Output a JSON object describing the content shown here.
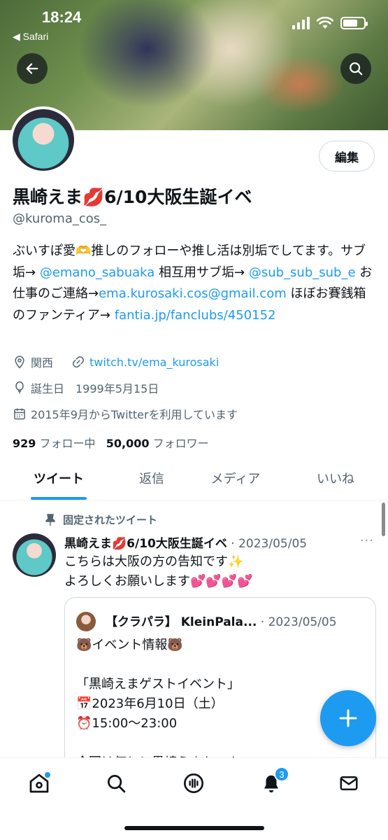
{
  "status_bar": {
    "time": "18:24",
    "back_app": "◀ Safari"
  },
  "profile": {
    "edit_label": "編集",
    "display_name": "黒崎えま💋6/10大阪生誕イベ",
    "handle": "@kuroma_cos_",
    "bio": {
      "p1": "ぶいすぽ愛🫶推しのフォローや推し活は別垢でしてます。サブ垢→ ",
      "link1": "@emano_sabuaka",
      "p2": " 相互用サブ垢→ ",
      "link2": "@sub_sub_sub_e",
      "p3": " お仕事のご連絡→",
      "link3": "ema.kurosaki.cos@gmail.com",
      "p4": " ほぼお賽銭箱のファンティア→ ",
      "link4": "fantia.jp/fanclubs/450152"
    },
    "location": "関西",
    "website": "twitch.tv/ema_kurosaki",
    "birthday": "誕生日　1999年5月15日",
    "joined": "2015年9月からTwitterを利用しています",
    "following_count": "929",
    "following_label": "フォロー中",
    "followers_count": "50,000",
    "followers_label": "フォロワー"
  },
  "tabs": [
    "ツイート",
    "返信",
    "メディア",
    "いいね"
  ],
  "tweet": {
    "pinned_label": "固定されたツイート",
    "author": "黒崎えま💋6/10大阪生誕イベ",
    "date": "· 2023/05/05",
    "more": "···",
    "line1": "こちらは大阪の方の告知です✨",
    "line2": "よろしくお願いします💕💕💕💕",
    "quote": {
      "author": "【クラパラ】 KleinPala...",
      "date": "· 2023/05/05",
      "text": "🐻イベント情報🐻\n\n「黒崎えまゲストイベント」\n📅2023年6月10日（土）\n⏰15:00～23:00\n\n今回は何と！黒崎えまちゃん"
    }
  },
  "nav": {
    "notifications_badge": "3"
  },
  "colors": {
    "accent": "#1d9bf0",
    "text": "#0f1419",
    "muted": "#536471"
  }
}
